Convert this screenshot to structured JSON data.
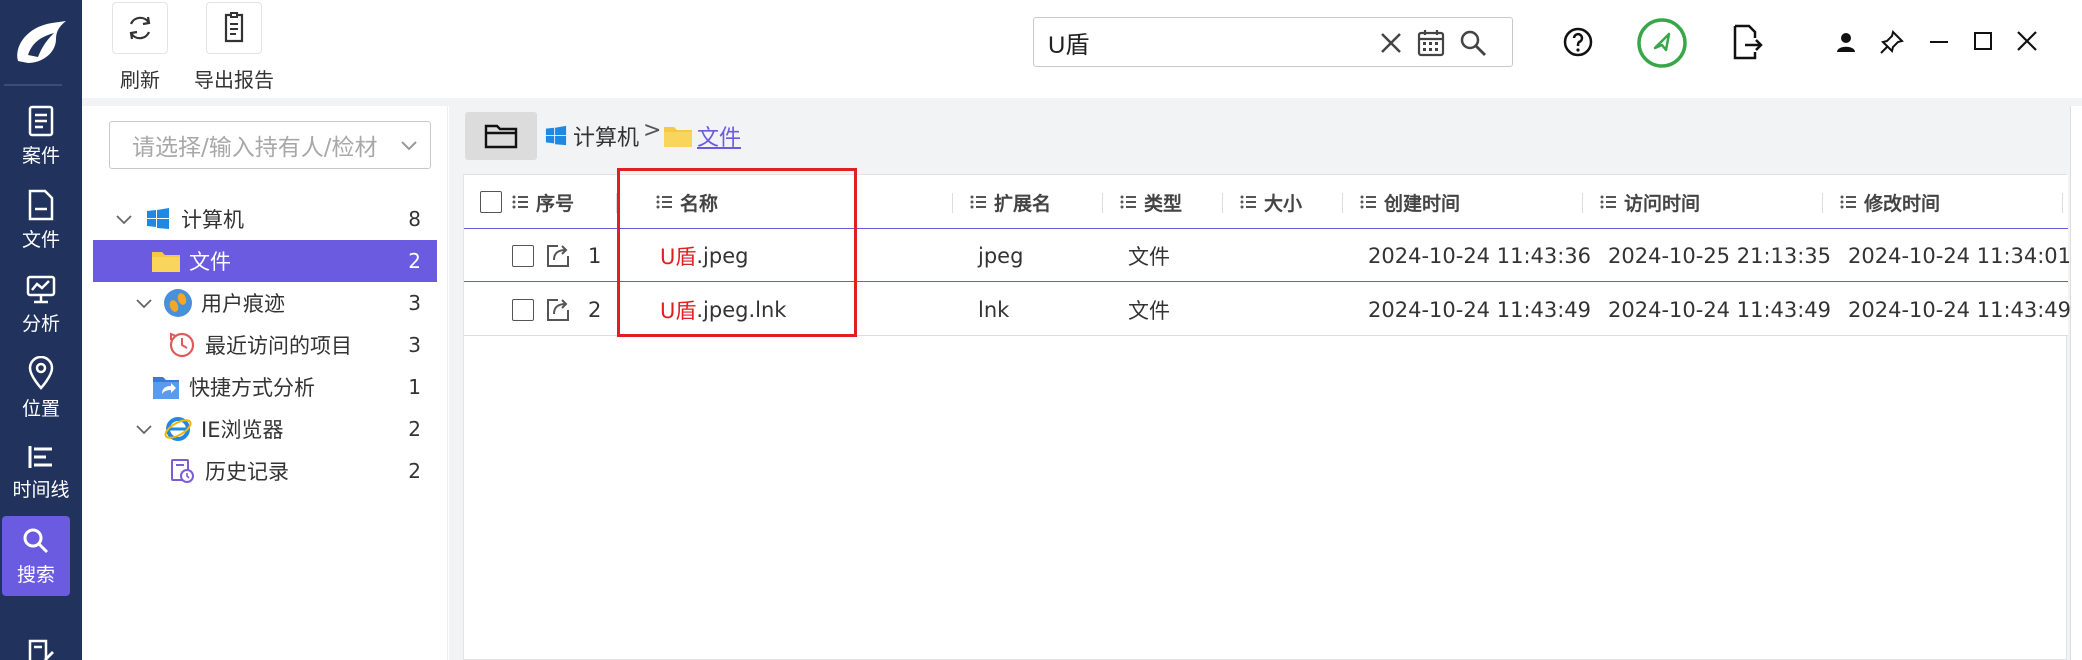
{
  "nav": {
    "items": [
      {
        "label": "案件",
        "icon": "case-icon"
      },
      {
        "label": "文件",
        "icon": "file-icon"
      },
      {
        "label": "分析",
        "icon": "analysis-icon"
      },
      {
        "label": "位置",
        "icon": "location-pin-icon"
      },
      {
        "label": "时间线",
        "icon": "timeline-icon"
      },
      {
        "label": "搜索",
        "icon": "search-icon",
        "active": true
      },
      {
        "label": "",
        "icon": "report-edit-icon"
      }
    ]
  },
  "toolbar": {
    "refresh_label": "刷新",
    "export_label": "导出报告"
  },
  "search": {
    "value": "U盾"
  },
  "holder_select": {
    "placeholder": "请选择/输入持有人/检材"
  },
  "tree": {
    "items": [
      {
        "label": "计算机",
        "count": "8",
        "icon": "windows-icon"
      },
      {
        "label": "文件",
        "count": "2",
        "icon": "folder-icon",
        "selected": true
      },
      {
        "label": "用户痕迹",
        "count": "3",
        "icon": "user-traces-icon"
      },
      {
        "label": "最近访问的项目",
        "count": "3",
        "icon": "recent-clock-icon"
      },
      {
        "label": "快捷方式分析",
        "count": "1",
        "icon": "shortcut-icon"
      },
      {
        "label": "IE浏览器",
        "count": "2",
        "icon": "ie-icon"
      },
      {
        "label": "历史记录",
        "count": "2",
        "icon": "history-icon"
      }
    ]
  },
  "breadcrumb": {
    "items": [
      "计算机",
      "文件"
    ],
    "separator": ">"
  },
  "table": {
    "columns": [
      "序号",
      "名称",
      "扩展名",
      "类型",
      "大小",
      "创建时间",
      "访问时间",
      "修改时间"
    ],
    "rows": [
      {
        "index": "1",
        "name_hl": "U盾",
        "name_rest": ".jpeg",
        "ext": "jpeg",
        "type": "文件",
        "size": "",
        "created": "2024-10-24 11:43:36",
        "accessed": "2024-10-25 21:13:35",
        "modified": "2024-10-24 11:34:01"
      },
      {
        "index": "2",
        "name_hl": "U盾",
        "name_rest": ".jpeg.lnk",
        "ext": "lnk",
        "type": "文件",
        "size": "",
        "created": "2024-10-24 11:43:49",
        "accessed": "2024-10-24 11:43:49",
        "modified": "2024-10-24 11:43:49"
      }
    ]
  },
  "colors": {
    "nav_bg": "#21325c",
    "accent": "#6a5be0",
    "highlight": "#e02020",
    "status_green": "#3aa64a"
  }
}
